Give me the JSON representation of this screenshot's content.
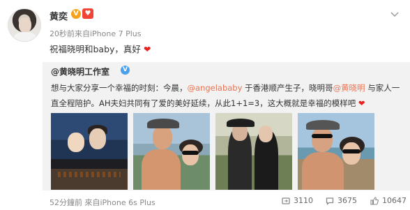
{
  "post": {
    "author": "黄奕",
    "vip_v": "V",
    "vip_badge": "♥",
    "meta": "20秒前来自iPhone 7 Plus",
    "text": "祝福晓明和baby，真好",
    "heart": "❤"
  },
  "repost": {
    "author": "@黄晓明工作室",
    "verified": "V",
    "text_part1": "想与大家分享一个幸福的时刻：今晨，",
    "mention1": "@angelababy",
    "text_part2": " 于香港顺产生子，晓明哥",
    "mention2": "@黄晓明",
    "text_part3": " 与家人一直全程陪护。AH夫妇共同有了爱的美好延续，从此1+1=3，这大概就是幸福的模样吧",
    "heart": "❤"
  },
  "footer": {
    "meta": "52分鐘前 來自iPhone 6s Plus",
    "reposts": "3110",
    "comments": "3675",
    "likes": "10647"
  },
  "icons": {
    "more": "chevron-down-icon",
    "repost": "repost-icon",
    "comment": "comment-icon",
    "like": "like-icon"
  },
  "colors": {
    "mention": "#eb7350",
    "heart": "#e8231f",
    "repost_bg": "#f2f2f2",
    "vip_gold": "#f7a21b",
    "verified_blue": "#4aa0ec"
  }
}
